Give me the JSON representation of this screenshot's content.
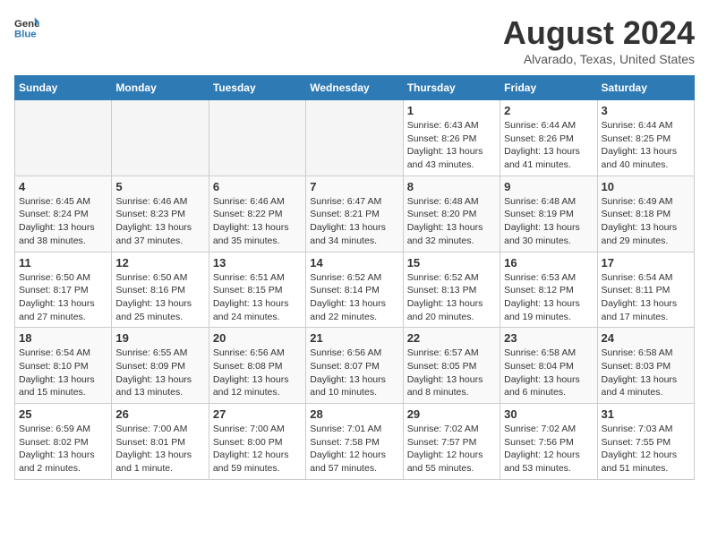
{
  "header": {
    "logo_line1": "General",
    "logo_line2": "Blue",
    "title": "August 2024",
    "subtitle": "Alvarado, Texas, United States"
  },
  "calendar": {
    "days_of_week": [
      "Sunday",
      "Monday",
      "Tuesday",
      "Wednesday",
      "Thursday",
      "Friday",
      "Saturday"
    ],
    "weeks": [
      {
        "days": [
          {
            "num": "",
            "info": ""
          },
          {
            "num": "",
            "info": ""
          },
          {
            "num": "",
            "info": ""
          },
          {
            "num": "",
            "info": ""
          },
          {
            "num": "1",
            "info": "Sunrise: 6:43 AM\nSunset: 8:26 PM\nDaylight: 13 hours\nand 43 minutes."
          },
          {
            "num": "2",
            "info": "Sunrise: 6:44 AM\nSunset: 8:26 PM\nDaylight: 13 hours\nand 41 minutes."
          },
          {
            "num": "3",
            "info": "Sunrise: 6:44 AM\nSunset: 8:25 PM\nDaylight: 13 hours\nand 40 minutes."
          }
        ]
      },
      {
        "days": [
          {
            "num": "4",
            "info": "Sunrise: 6:45 AM\nSunset: 8:24 PM\nDaylight: 13 hours\nand 38 minutes."
          },
          {
            "num": "5",
            "info": "Sunrise: 6:46 AM\nSunset: 8:23 PM\nDaylight: 13 hours\nand 37 minutes."
          },
          {
            "num": "6",
            "info": "Sunrise: 6:46 AM\nSunset: 8:22 PM\nDaylight: 13 hours\nand 35 minutes."
          },
          {
            "num": "7",
            "info": "Sunrise: 6:47 AM\nSunset: 8:21 PM\nDaylight: 13 hours\nand 34 minutes."
          },
          {
            "num": "8",
            "info": "Sunrise: 6:48 AM\nSunset: 8:20 PM\nDaylight: 13 hours\nand 32 minutes."
          },
          {
            "num": "9",
            "info": "Sunrise: 6:48 AM\nSunset: 8:19 PM\nDaylight: 13 hours\nand 30 minutes."
          },
          {
            "num": "10",
            "info": "Sunrise: 6:49 AM\nSunset: 8:18 PM\nDaylight: 13 hours\nand 29 minutes."
          }
        ]
      },
      {
        "days": [
          {
            "num": "11",
            "info": "Sunrise: 6:50 AM\nSunset: 8:17 PM\nDaylight: 13 hours\nand 27 minutes."
          },
          {
            "num": "12",
            "info": "Sunrise: 6:50 AM\nSunset: 8:16 PM\nDaylight: 13 hours\nand 25 minutes."
          },
          {
            "num": "13",
            "info": "Sunrise: 6:51 AM\nSunset: 8:15 PM\nDaylight: 13 hours\nand 24 minutes."
          },
          {
            "num": "14",
            "info": "Sunrise: 6:52 AM\nSunset: 8:14 PM\nDaylight: 13 hours\nand 22 minutes."
          },
          {
            "num": "15",
            "info": "Sunrise: 6:52 AM\nSunset: 8:13 PM\nDaylight: 13 hours\nand 20 minutes."
          },
          {
            "num": "16",
            "info": "Sunrise: 6:53 AM\nSunset: 8:12 PM\nDaylight: 13 hours\nand 19 minutes."
          },
          {
            "num": "17",
            "info": "Sunrise: 6:54 AM\nSunset: 8:11 PM\nDaylight: 13 hours\nand 17 minutes."
          }
        ]
      },
      {
        "days": [
          {
            "num": "18",
            "info": "Sunrise: 6:54 AM\nSunset: 8:10 PM\nDaylight: 13 hours\nand 15 minutes."
          },
          {
            "num": "19",
            "info": "Sunrise: 6:55 AM\nSunset: 8:09 PM\nDaylight: 13 hours\nand 13 minutes."
          },
          {
            "num": "20",
            "info": "Sunrise: 6:56 AM\nSunset: 8:08 PM\nDaylight: 13 hours\nand 12 minutes."
          },
          {
            "num": "21",
            "info": "Sunrise: 6:56 AM\nSunset: 8:07 PM\nDaylight: 13 hours\nand 10 minutes."
          },
          {
            "num": "22",
            "info": "Sunrise: 6:57 AM\nSunset: 8:05 PM\nDaylight: 13 hours\nand 8 minutes."
          },
          {
            "num": "23",
            "info": "Sunrise: 6:58 AM\nSunset: 8:04 PM\nDaylight: 13 hours\nand 6 minutes."
          },
          {
            "num": "24",
            "info": "Sunrise: 6:58 AM\nSunset: 8:03 PM\nDaylight: 13 hours\nand 4 minutes."
          }
        ]
      },
      {
        "days": [
          {
            "num": "25",
            "info": "Sunrise: 6:59 AM\nSunset: 8:02 PM\nDaylight: 13 hours\nand 2 minutes."
          },
          {
            "num": "26",
            "info": "Sunrise: 7:00 AM\nSunset: 8:01 PM\nDaylight: 13 hours\nand 1 minute."
          },
          {
            "num": "27",
            "info": "Sunrise: 7:00 AM\nSunset: 8:00 PM\nDaylight: 12 hours\nand 59 minutes."
          },
          {
            "num": "28",
            "info": "Sunrise: 7:01 AM\nSunset: 7:58 PM\nDaylight: 12 hours\nand 57 minutes."
          },
          {
            "num": "29",
            "info": "Sunrise: 7:02 AM\nSunset: 7:57 PM\nDaylight: 12 hours\nand 55 minutes."
          },
          {
            "num": "30",
            "info": "Sunrise: 7:02 AM\nSunset: 7:56 PM\nDaylight: 12 hours\nand 53 minutes."
          },
          {
            "num": "31",
            "info": "Sunrise: 7:03 AM\nSunset: 7:55 PM\nDaylight: 12 hours\nand 51 minutes."
          }
        ]
      }
    ]
  }
}
